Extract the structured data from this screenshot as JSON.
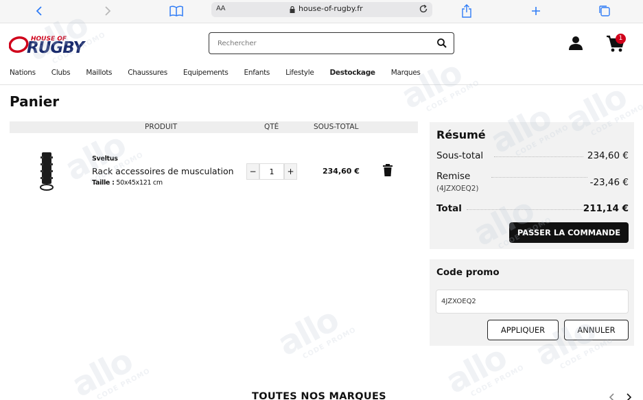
{
  "browser": {
    "aa_label": "AA",
    "url": "house-of-rugby.fr"
  },
  "header": {
    "search_placeholder": "Rechercher",
    "cart_count": "1",
    "logo_text_top": "HOUSE OF",
    "logo_text_main": "RUGBY"
  },
  "nav": [
    "Nations",
    "Clubs",
    "Maillots",
    "Chaussures",
    "Equipements",
    "Enfants",
    "Lifestyle",
    "Destockage",
    "Marques"
  ],
  "cart": {
    "title": "Panier",
    "col_product": "PRODUIT",
    "col_qty": "QTÉ",
    "col_subtotal": "SOUS-TOTAL",
    "item": {
      "brand": "Sveltus",
      "name": "Rack accessoires de musculation",
      "size_label": "Taille :",
      "size_value": "50x45x121 cm",
      "qty": "1",
      "qty_minus": "−",
      "qty_plus": "+",
      "subtotal": "234,60 €"
    }
  },
  "summary": {
    "title": "Résumé",
    "subtotal_label": "Sous-total",
    "subtotal_value": "234,60 €",
    "discount_label": "Remise",
    "discount_code": "(4JZXOEQ2)",
    "discount_value": "-23,46 €",
    "total_label": "Total",
    "total_value": "211,14 €",
    "checkout": "PASSER LA COMMANDE"
  },
  "promo": {
    "title": "Code promo",
    "code_value": "4JZXOEQ2",
    "apply": "APPLIQUER",
    "cancel": "ANNULER"
  },
  "brands": {
    "title": "TOUTES NOS MARQUES"
  },
  "watermark": {
    "big": "allo",
    "small": "CODE PROMO"
  },
  "colors": {
    "accent_red": "#d0021b",
    "logo_blue": "#1a2b6d",
    "button_dark": "#111111"
  }
}
